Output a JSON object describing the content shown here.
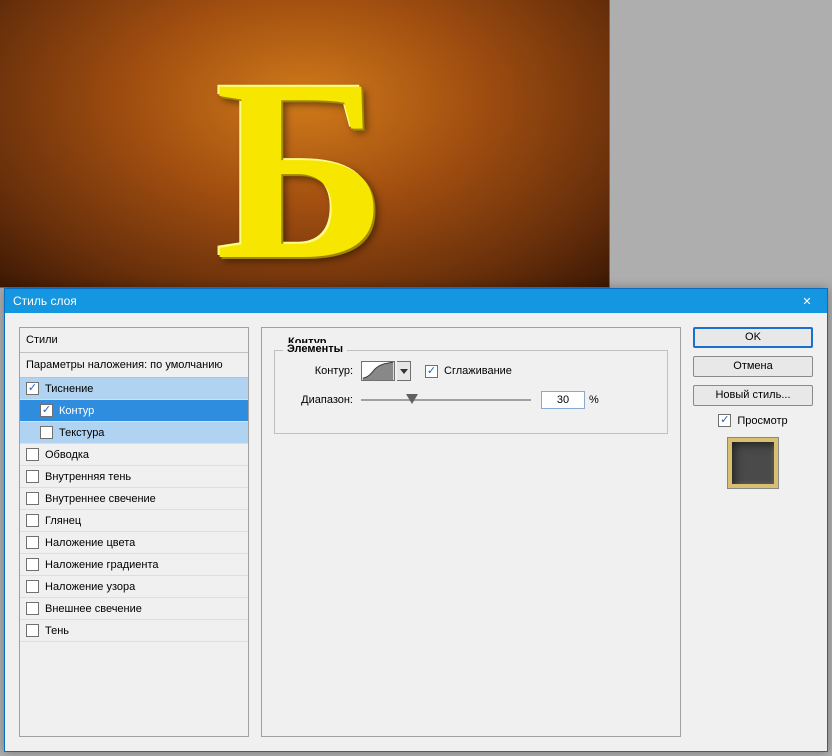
{
  "canvas": {
    "letter": "Б"
  },
  "dialog": {
    "title": "Стиль слоя",
    "styles_header": "Стили",
    "defaults_label": "Параметры наложения: по умолчанию",
    "items": [
      {
        "label": "Тиснение",
        "checked": true,
        "indent": false,
        "sel": "group"
      },
      {
        "label": "Контур",
        "checked": true,
        "indent": true,
        "sel": "active"
      },
      {
        "label": "Текстура",
        "checked": false,
        "indent": true,
        "sel": "sub"
      },
      {
        "label": "Обводка",
        "checked": false,
        "indent": false,
        "sel": ""
      },
      {
        "label": "Внутренняя тень",
        "checked": false,
        "indent": false,
        "sel": ""
      },
      {
        "label": "Внутреннее свечение",
        "checked": false,
        "indent": false,
        "sel": ""
      },
      {
        "label": "Глянец",
        "checked": false,
        "indent": false,
        "sel": ""
      },
      {
        "label": "Наложение цвета",
        "checked": false,
        "indent": false,
        "sel": ""
      },
      {
        "label": "Наложение градиента",
        "checked": false,
        "indent": false,
        "sel": ""
      },
      {
        "label": "Наложение узора",
        "checked": false,
        "indent": false,
        "sel": ""
      },
      {
        "label": "Внешнее свечение",
        "checked": false,
        "indent": false,
        "sel": ""
      },
      {
        "label": "Тень",
        "checked": false,
        "indent": false,
        "sel": ""
      }
    ]
  },
  "center": {
    "section_title": "Контур",
    "fieldset_title": "Элементы",
    "contour_label": "Контур:",
    "antialias_label": "Сглаживание",
    "antialias_checked": true,
    "range_label": "Диапазон:",
    "range_value": "30",
    "range_suffix": "%",
    "range_pct": 30
  },
  "buttons": {
    "ok": "OK",
    "cancel": "Отмена",
    "new_style": "Новый стиль...",
    "preview_label": "Просмотр",
    "preview_checked": true
  }
}
